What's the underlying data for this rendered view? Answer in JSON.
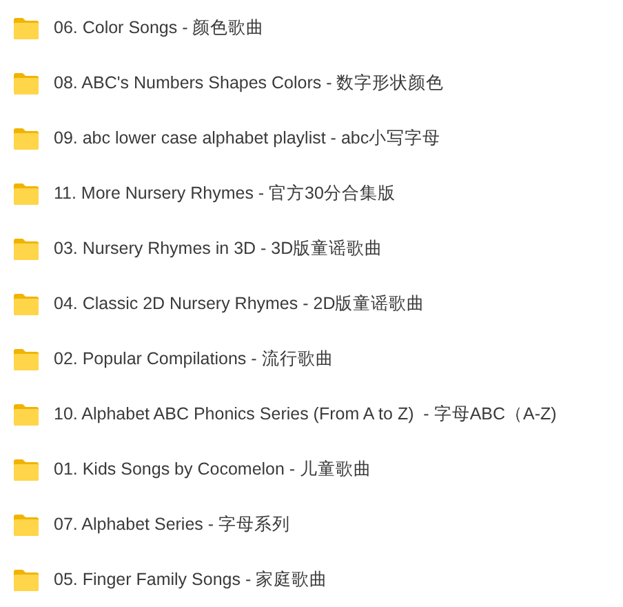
{
  "folders": [
    {
      "name": "06. Color Songs - 颜色歌曲"
    },
    {
      "name": "08. ABC's Numbers Shapes Colors - 数字形状颜色"
    },
    {
      "name": "09. abc lower case alphabet playlist - abc小写字母"
    },
    {
      "name": "11. More Nursery Rhymes - 官方30分合集版"
    },
    {
      "name": "03. Nursery Rhymes in 3D - 3D版童谣歌曲"
    },
    {
      "name": "04. Classic 2D Nursery Rhymes - 2D版童谣歌曲"
    },
    {
      "name": "02. Popular Compilations - 流行歌曲"
    },
    {
      "name": "10. Alphabet ABC Phonics Series (From A to Z)  - 字母ABC（A-Z)"
    },
    {
      "name": "01. Kids Songs by Cocomelon - 儿童歌曲"
    },
    {
      "name": "07. Alphabet Series - 字母系列"
    },
    {
      "name": "05. Finger Family Songs - 家庭歌曲"
    }
  ]
}
